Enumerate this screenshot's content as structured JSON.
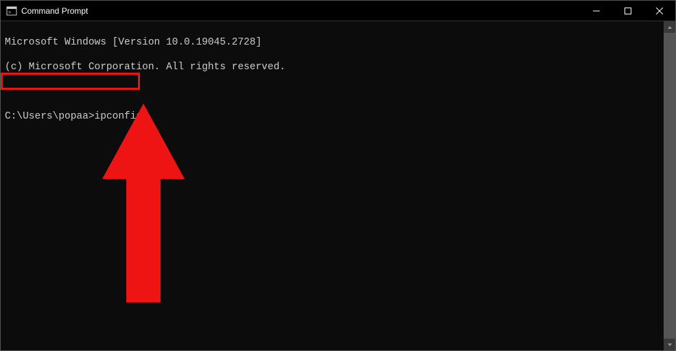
{
  "window": {
    "title": "Command Prompt"
  },
  "terminal": {
    "line1": "Microsoft Windows [Version 10.0.19045.2728]",
    "line2": "(c) Microsoft Corporation. All rights reserved.",
    "prompt": "C:\\Users\\popaa>",
    "command": "ipconfig"
  },
  "annotation": {
    "color": "#ef1414"
  }
}
